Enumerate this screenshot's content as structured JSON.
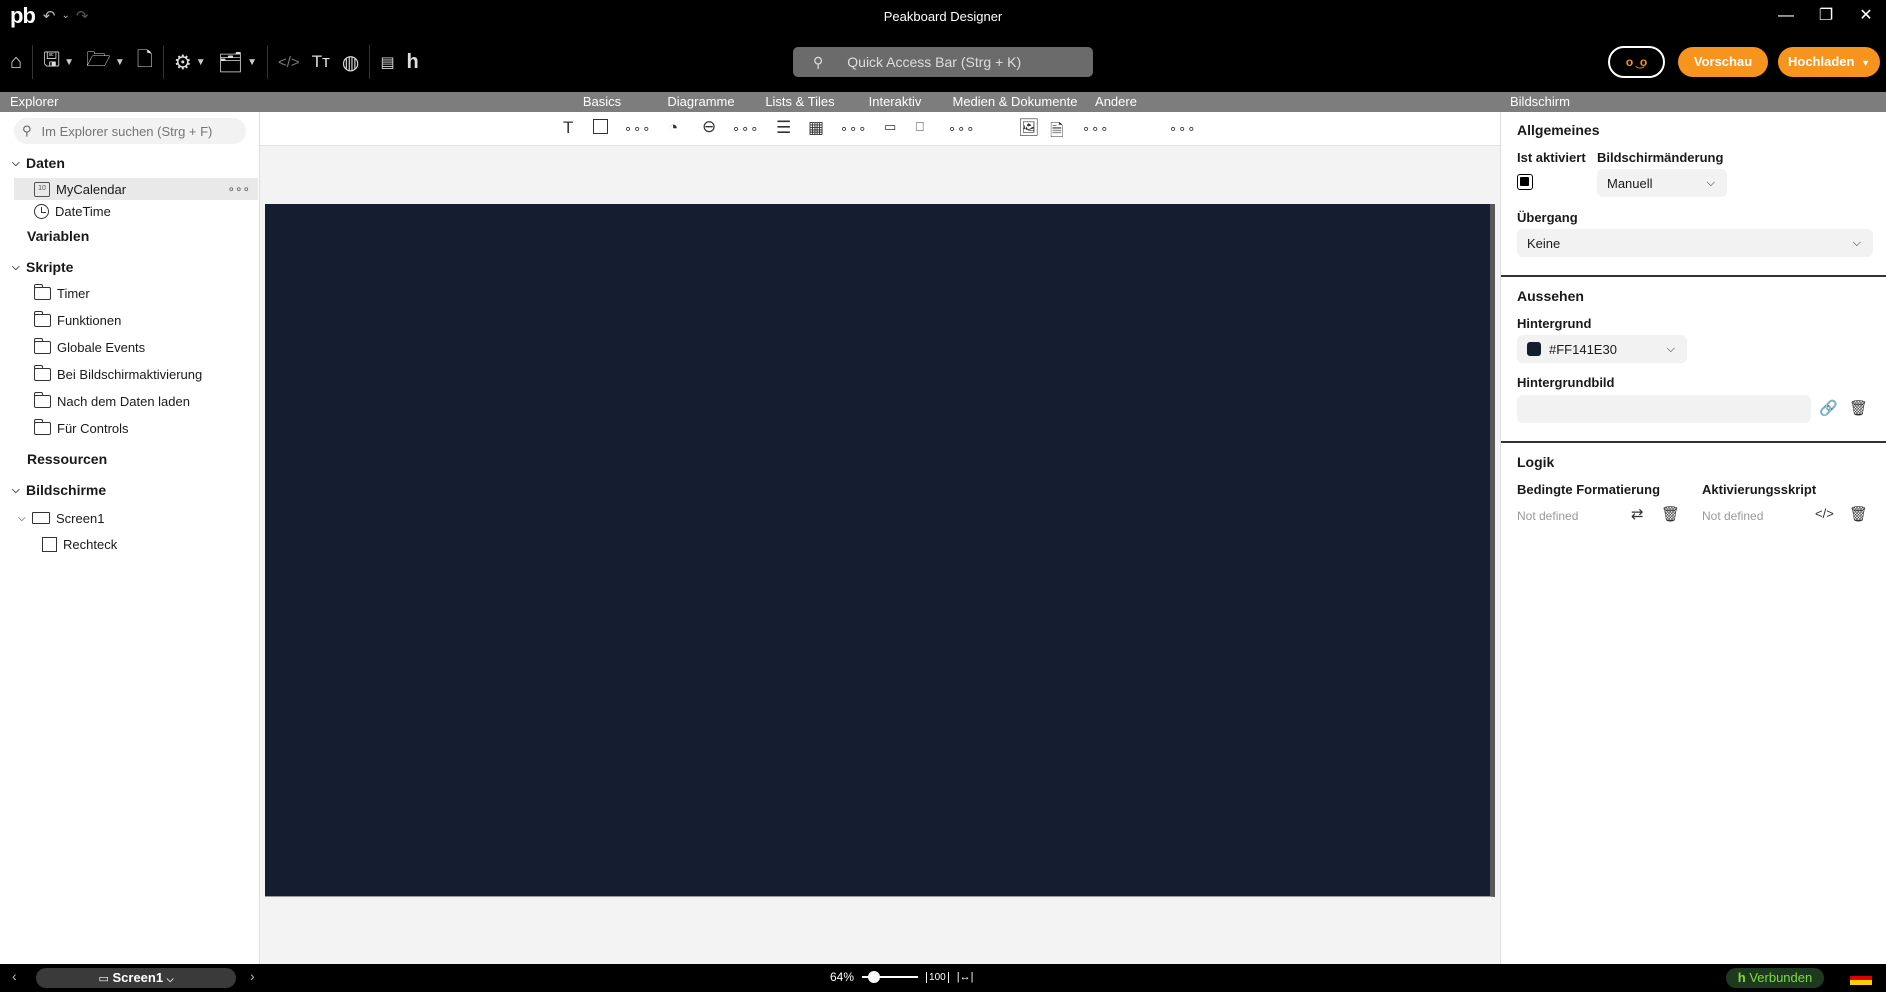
{
  "app": {
    "title": "Peakboard Designer",
    "logo": "pb"
  },
  "toolbar": {
    "quick_access_placeholder": "Quick Access Bar (Strg + K)",
    "preview_label": "Vorschau",
    "upload_label": "Hochladen"
  },
  "subheader": {
    "explorer_label": "Explorer",
    "properties_label": "Bildschirm",
    "categories": [
      "Basics",
      "Diagramme",
      "Lists & Tiles",
      "Interaktiv",
      "Medien & Dokumente",
      "Andere"
    ]
  },
  "explorer": {
    "search_placeholder": "Im Explorer suchen (Strg + F)",
    "sections": {
      "daten": "Daten",
      "variablen": "Variablen",
      "skripte": "Skripte",
      "ressourcen": "Ressourcen",
      "bildschirme": "Bildschirme"
    },
    "data_items": [
      "MyCalendar",
      "DateTime"
    ],
    "script_items": [
      "Timer",
      "Funktionen",
      "Globale Events",
      "Bei Bildschirmaktivierung",
      "Nach dem Daten laden",
      "Für Controls"
    ],
    "screen": "Screen1",
    "screen_child": "Rechteck",
    "calendar_icon_text": "10"
  },
  "properties": {
    "allgemeines": "Allgemeines",
    "ist_aktiviert": "Ist aktiviert",
    "bildschirmaenderung": "Bildschirmänderung",
    "bildschirmaenderung_value": "Manuell",
    "uebergang": "Übergang",
    "uebergang_value": "Keine",
    "aussehen": "Aussehen",
    "hintergrund": "Hintergrund",
    "hintergrund_value": "#FF141E30",
    "hintergrundbild": "Hintergrundbild",
    "logik": "Logik",
    "bedingte_formatierung": "Bedingte Formatierung",
    "aktivierungsskript": "Aktivierungsskript",
    "not_defined": "Not defined"
  },
  "canvas": {
    "background": "#141e30"
  },
  "statusbar": {
    "screen": "Screen1",
    "zoom": "64%",
    "status": "Verbunden"
  },
  "colors": {
    "accent": "#f7941d",
    "connected": "#7ddb3c"
  }
}
